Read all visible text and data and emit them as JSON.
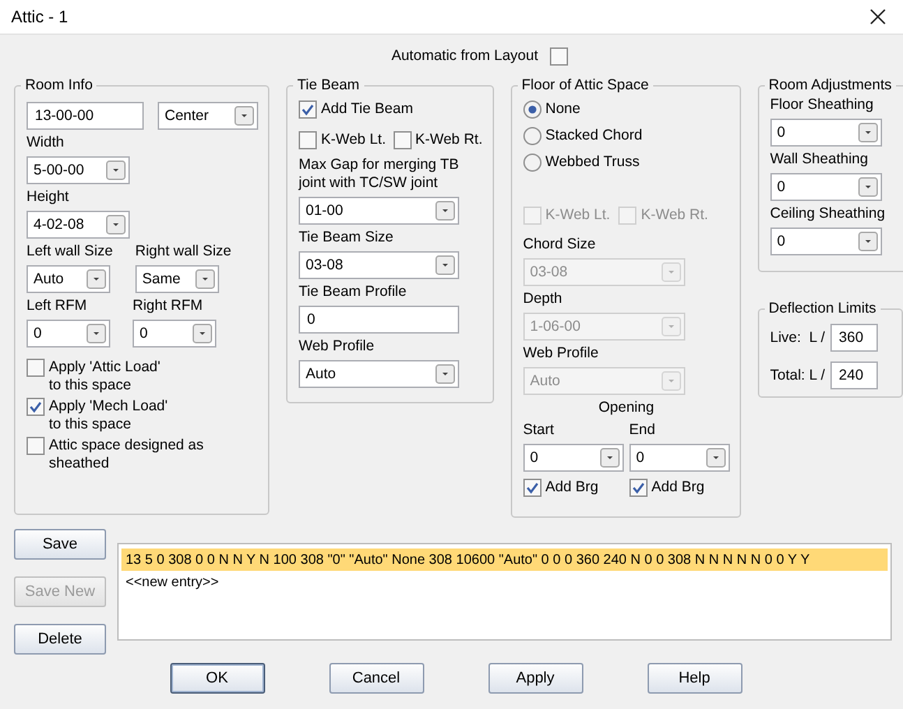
{
  "window": {
    "title": "Attic - 1"
  },
  "automatic_from_layout": {
    "label": "Automatic from Layout",
    "checked": false
  },
  "room_info": {
    "title": "Room Info",
    "span": {
      "value": "13-00-00"
    },
    "position": {
      "value": "Center"
    },
    "width": {
      "label": "Width",
      "value": "5-00-00"
    },
    "height": {
      "label": "Height",
      "value": "4-02-08"
    },
    "left_wall_size": {
      "label": "Left wall Size",
      "value": "Auto"
    },
    "right_wall_size": {
      "label": "Right wall Size",
      "value": "Same"
    },
    "left_rfm": {
      "label": "Left RFM",
      "value": "0"
    },
    "right_rfm": {
      "label": "Right RFM",
      "value": "0"
    },
    "options": [
      {
        "label": "Apply 'Attic Load'\nto this space",
        "checked": false
      },
      {
        "label": "Apply 'Mech Load'\nto this space",
        "checked": true
      },
      {
        "label": "Attic space designed as\nsheathed",
        "checked": false
      }
    ]
  },
  "tie_beam": {
    "title": "Tie Beam",
    "add_tie_beam": {
      "label": "Add Tie Beam",
      "checked": true
    },
    "k_webs": [
      {
        "label": "K-Web Lt.",
        "checked": false,
        "disabled": false
      },
      {
        "label": "K-Web Rt.",
        "checked": false,
        "disabled": false
      }
    ],
    "max_gap": {
      "label": "Max Gap for merging TB\njoint with TC/SW joint",
      "value": "01-00"
    },
    "size": {
      "label": "Tie Beam Size",
      "value": "03-08"
    },
    "profile": {
      "label": "Tie Beam Profile",
      "value": "0"
    },
    "web_profile": {
      "label": "Web Profile",
      "value": "Auto"
    }
  },
  "floor": {
    "title": "Floor of Attic Space",
    "types": [
      {
        "label": "None",
        "selected": true
      },
      {
        "label": "Stacked Chord",
        "selected": false
      },
      {
        "label": "Webbed Truss",
        "selected": false
      }
    ],
    "k_webs": [
      {
        "label": "K-Web Lt.",
        "checked": false,
        "disabled": true
      },
      {
        "label": "K-Web Rt.",
        "checked": false,
        "disabled": true
      }
    ],
    "chord_size": {
      "label": "Chord Size",
      "value": "03-08",
      "disabled": true
    },
    "depth": {
      "label": "Depth",
      "value": "1-06-00",
      "disabled": true
    },
    "web_profile": {
      "label": "Web Profile",
      "value": "Auto",
      "disabled": true
    },
    "opening": {
      "title": "Opening",
      "ends": [
        {
          "label": "Start",
          "value": "0",
          "add_brg": {
            "label": "Add Brg",
            "checked": true
          }
        },
        {
          "label": "End",
          "value": "0",
          "add_brg": {
            "label": "Add Brg",
            "checked": true
          }
        }
      ]
    }
  },
  "room_adjustments": {
    "title": "Room Adjustments",
    "items": [
      {
        "label": "Floor Sheathing",
        "value": "0"
      },
      {
        "label": "Wall Sheathing",
        "value": "0"
      },
      {
        "label": "Ceiling Sheathing",
        "value": "0"
      }
    ]
  },
  "deflection_limits": {
    "title": "Deflection Limits",
    "items": [
      {
        "label": "Live:  L /",
        "value": "360"
      },
      {
        "label": "Total: L /",
        "value": "240"
      }
    ]
  },
  "side_buttons": [
    {
      "label": "Save",
      "disabled": false
    },
    {
      "label": "Save New",
      "disabled": true
    },
    {
      "label": "Delete",
      "disabled": false
    }
  ],
  "entries": [
    {
      "text": "13 5 0 308 0 0 N N Y N 100 308 \"0\" \"Auto\" None 308 10600 \"Auto\" 0 0 0 360 240 N 0 0 308 N N N N N 0 0 Y Y",
      "selected": true
    },
    {
      "text": "<<new entry>>",
      "selected": false
    }
  ],
  "footer_buttons": [
    {
      "label": "OK",
      "default": true
    },
    {
      "label": "Cancel",
      "default": false
    },
    {
      "label": "Apply",
      "default": false
    },
    {
      "label": "Help",
      "default": false
    }
  ]
}
